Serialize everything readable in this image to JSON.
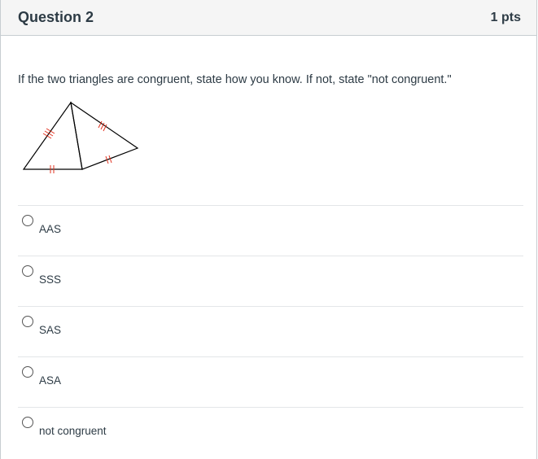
{
  "question": {
    "title": "Question 2",
    "points": "1 pts",
    "prompt": "If the two triangles are congruent, state how you know. If not, state \"not congruent.\""
  },
  "answers": [
    {
      "label": "AAS"
    },
    {
      "label": "SSS"
    },
    {
      "label": "SAS"
    },
    {
      "label": "ASA"
    },
    {
      "label": "not congruent"
    }
  ],
  "colors": {
    "tick_marks": "#e0301e",
    "header_bg": "#f5f5f5"
  }
}
